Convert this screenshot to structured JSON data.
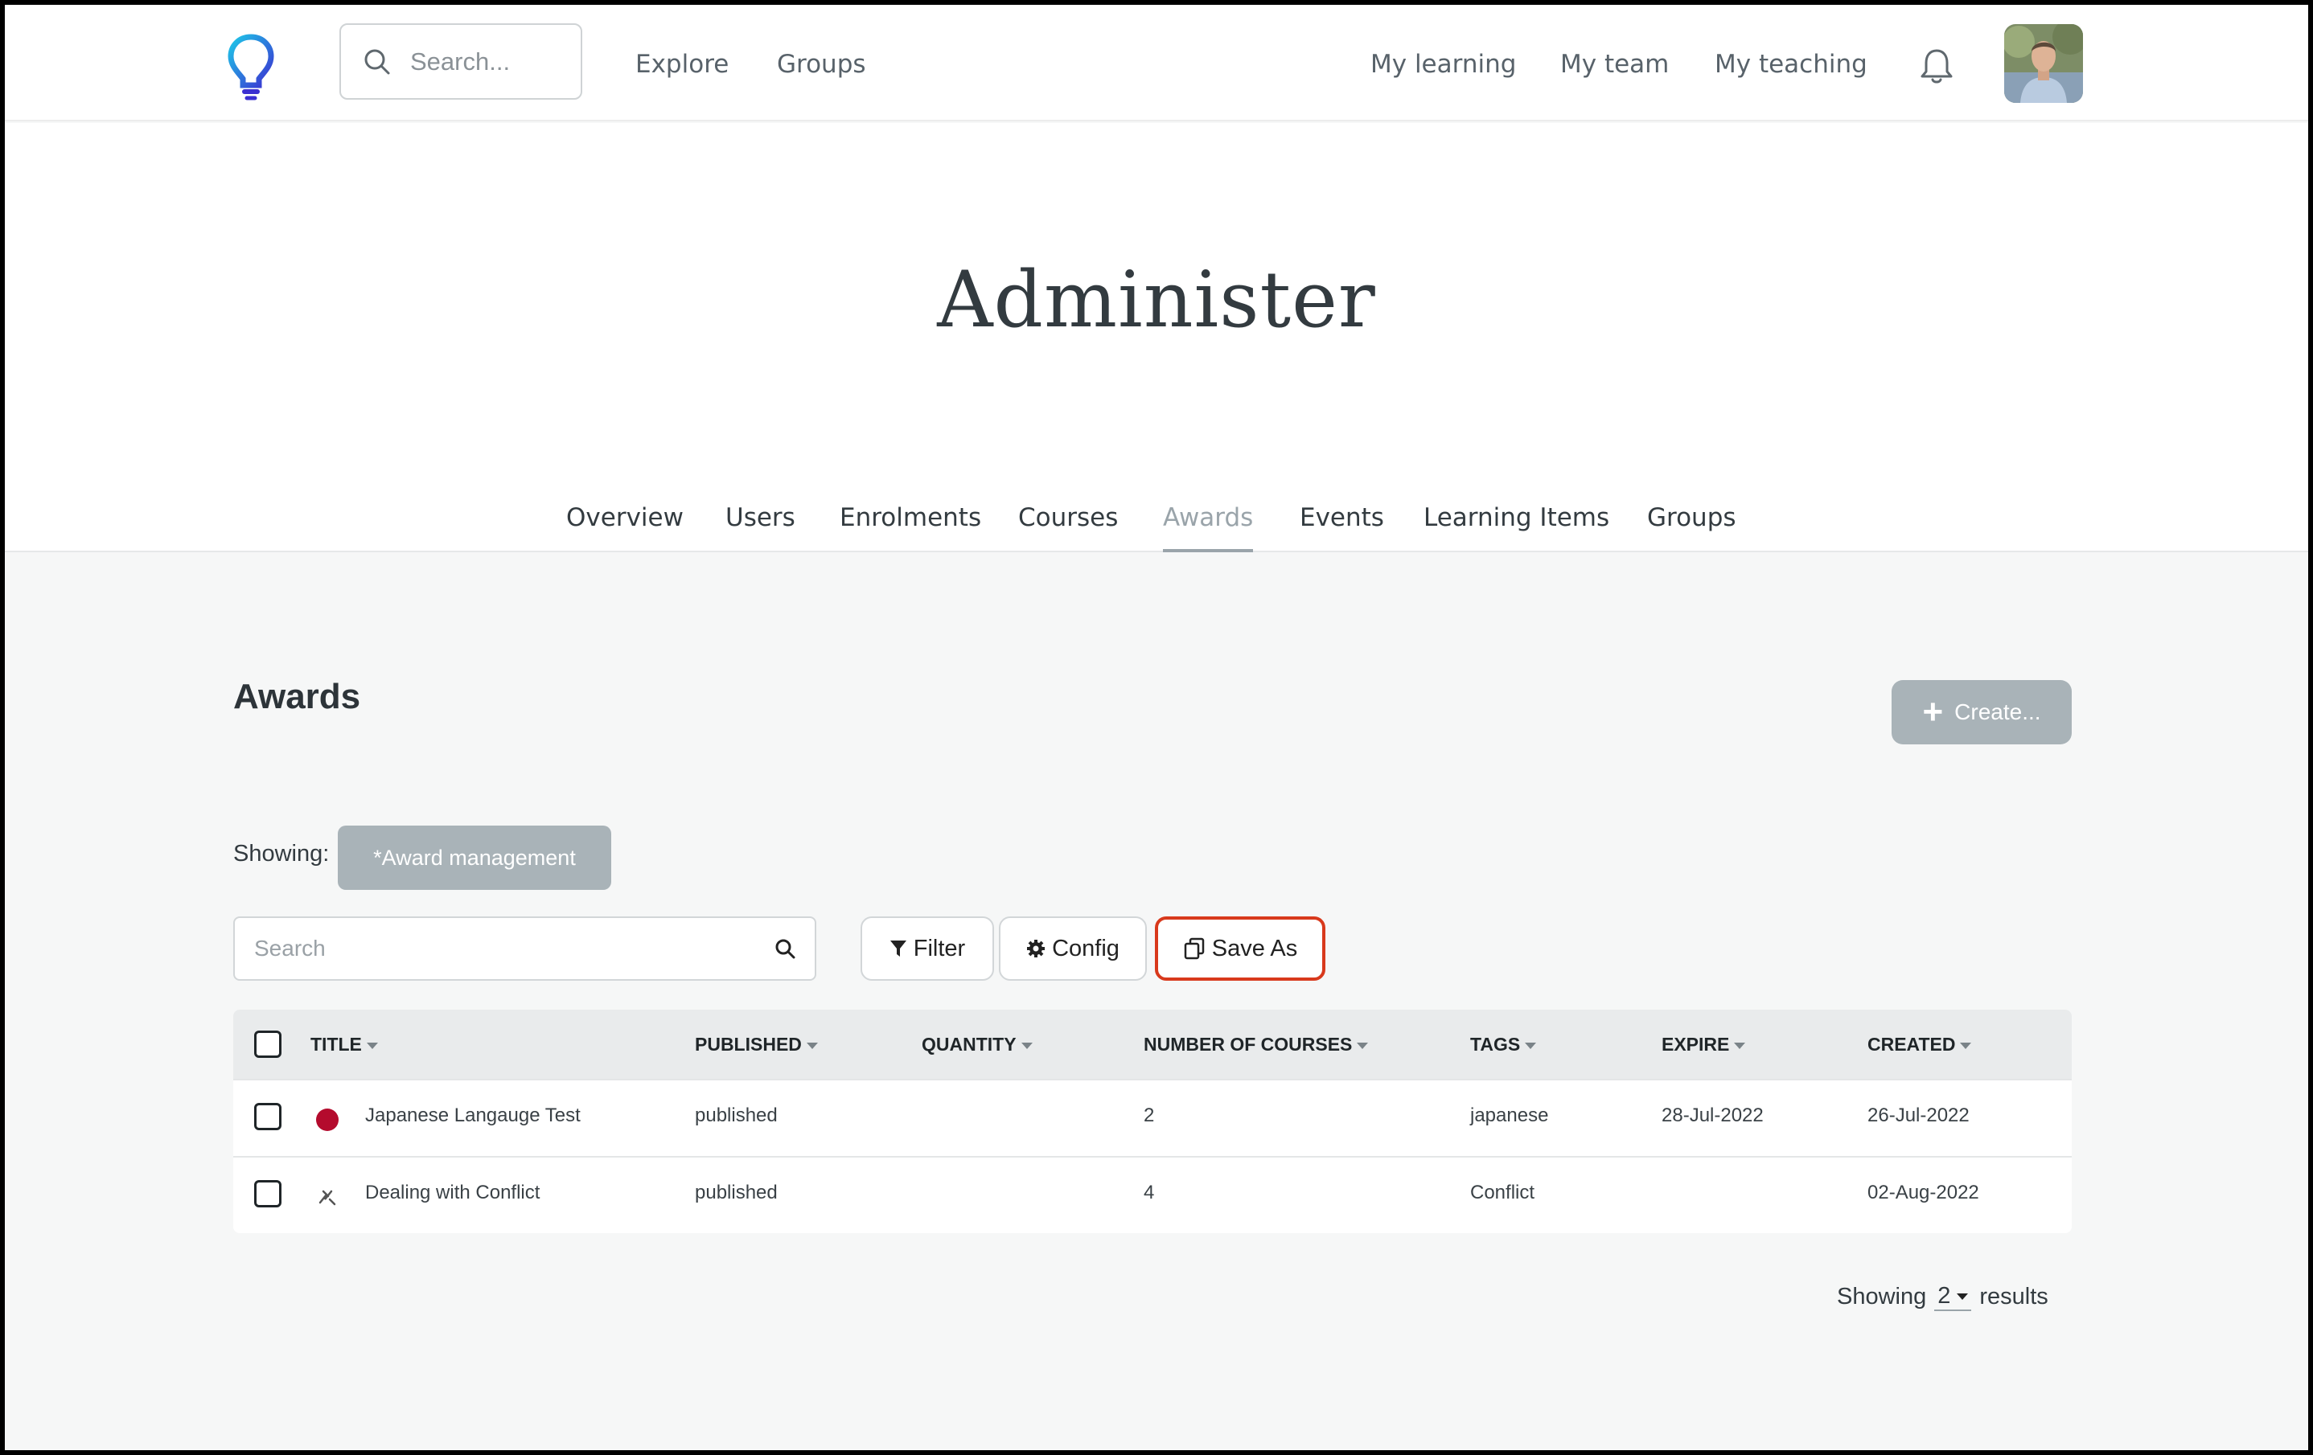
{
  "header": {
    "search_placeholder": "Search...",
    "nav_left": [
      "Explore",
      "Groups"
    ],
    "nav_right": [
      "My learning",
      "My team",
      "My teaching"
    ]
  },
  "page": {
    "title": "Administer",
    "tabs": [
      "Overview",
      "Users",
      "Enrolments",
      "Courses",
      "Awards",
      "Events",
      "Learning Items",
      "Groups"
    ],
    "active_tab": "Awards"
  },
  "awards": {
    "title": "Awards",
    "create_label": "Create...",
    "showing_label": "Showing:",
    "view_name": "*Award management",
    "search_placeholder": "Search",
    "filter_label": "Filter",
    "config_label": "Config",
    "save_as_label": "Save As",
    "columns": [
      "TITLE",
      "PUBLISHED",
      "QUANTITY",
      "NUMBER OF COURSES",
      "TAGS",
      "EXPIRE",
      "CREATED"
    ],
    "rows": [
      {
        "title": "Japanese Langauge Test",
        "published": "published",
        "quantity": "",
        "courses": "2",
        "tags": "japanese",
        "expire": "28-Jul-2022",
        "created": "26-Jul-2022",
        "icon": "japan-flag-icon"
      },
      {
        "title": "Dealing with Conflict",
        "published": "published",
        "quantity": "",
        "courses": "4",
        "tags": "Conflict",
        "expire": "",
        "created": "02-Aug-2022",
        "icon": "conflict-icon"
      }
    ],
    "results_prefix": "Showing",
    "results_count": "2",
    "results_suffix": "results"
  },
  "colors": {
    "accent_highlight": "#d8391c",
    "button_grey": "#a9b3b8",
    "logo_blue": "#1ea7e4",
    "logo_purple": "#3b2fd1"
  }
}
